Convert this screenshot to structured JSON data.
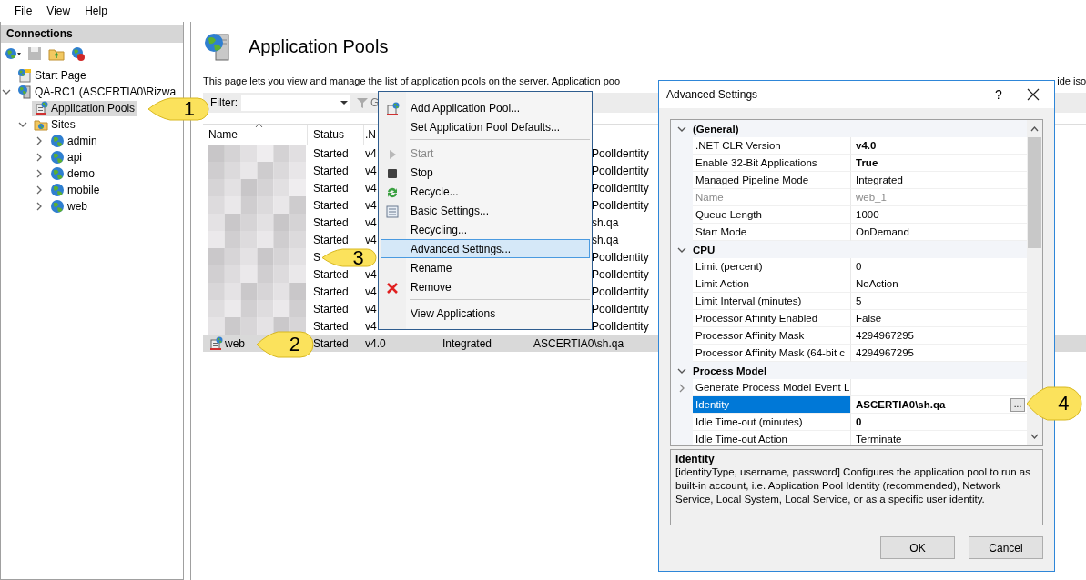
{
  "menu_bar": [
    "File",
    "View",
    "Help"
  ],
  "connections": {
    "title": "Connections",
    "tree": [
      {
        "label": "Start Page",
        "kind": "start",
        "selected": false
      },
      {
        "label": "QA-RC1 (ASCERTIA0\\Rizwa",
        "kind": "server",
        "selected": false,
        "expanded": true,
        "children": [
          {
            "label": "Application Pools",
            "kind": "pools",
            "selected": true
          },
          {
            "label": "Sites",
            "kind": "folder",
            "selected": false,
            "expanded": true,
            "children": [
              {
                "label": "admin",
                "kind": "site",
                "selected": false,
                "expanded": false
              },
              {
                "label": "api",
                "kind": "site",
                "selected": false,
                "expanded": false
              },
              {
                "label": "demo",
                "kind": "site",
                "selected": false,
                "expanded": false
              },
              {
                "label": "mobile",
                "kind": "site",
                "selected": false,
                "expanded": false
              },
              {
                "label": "web",
                "kind": "site",
                "selected": false,
                "expanded": false
              }
            ]
          }
        ]
      }
    ]
  },
  "page": {
    "title": "Application Pools",
    "description": "This page lets you view and manage the list of application pools on the server. Application poo",
    "description_right": "ide iso",
    "filter_label": "Filter:",
    "go_button": "G"
  },
  "list": {
    "columns": [
      "Name",
      "Status",
      ".N"
    ],
    "rows": [
      {
        "status": "Started",
        "version": "v4",
        "identity": "PoolIdentity",
        "selected": false
      },
      {
        "status": "Started",
        "version": "v4",
        "identity": "PoolIdentity",
        "selected": false
      },
      {
        "status": "Started",
        "version": "v4",
        "identity": "PoolIdentity",
        "selected": false
      },
      {
        "status": "Started",
        "version": "v4",
        "identity": "PoolIdentity",
        "selected": false
      },
      {
        "status": "Started",
        "version": "v4",
        "identity": "sh.qa",
        "selected": false
      },
      {
        "status": "Started",
        "version": "v4",
        "identity": "sh.qa",
        "selected": false
      },
      {
        "status": "S",
        "identity": "PoolIdentity",
        "selected": false
      },
      {
        "status": "Started",
        "version": "v4",
        "identity": "PoolIdentity",
        "selected": false
      },
      {
        "status": "Started",
        "version": "v4",
        "identity": "PoolIdentity",
        "selected": false
      },
      {
        "status": "Started",
        "version": "v4",
        "identity": "PoolIdentity",
        "selected": false
      },
      {
        "status": "Started",
        "version": "v4",
        "identity": "PoolIdentity",
        "selected": false
      },
      {
        "name": "web",
        "status": "Started",
        "version": "v4.0",
        "pipeline": "Integrated",
        "identity": "ASCERTIA0\\sh.qa",
        "selected": true
      }
    ]
  },
  "context_menu": [
    {
      "kind": "item",
      "label": "Add Application Pool...",
      "disabled": false,
      "selected": false
    },
    {
      "kind": "item",
      "label": "Set Application Pool Defaults...",
      "disabled": false,
      "selected": false
    },
    {
      "kind": "separator"
    },
    {
      "kind": "item",
      "label": "Start",
      "disabled": true,
      "selected": false
    },
    {
      "kind": "item",
      "label": "Stop",
      "disabled": false,
      "selected": false
    },
    {
      "kind": "item",
      "label": "Recycle...",
      "disabled": false,
      "selected": false
    },
    {
      "kind": "item",
      "label": "Basic Settings...",
      "disabled": false,
      "selected": false
    },
    {
      "kind": "item",
      "label": "Recycling...",
      "disabled": false,
      "selected": false
    },
    {
      "kind": "item",
      "label": "Advanced Settings...",
      "disabled": false,
      "selected": true
    },
    {
      "kind": "item",
      "label": "Rename",
      "disabled": false,
      "selected": false
    },
    {
      "kind": "item",
      "label": "Remove",
      "disabled": false,
      "selected": false
    },
    {
      "kind": "separator"
    },
    {
      "kind": "item",
      "label": "View Applications",
      "disabled": false,
      "selected": false
    }
  ],
  "dialog": {
    "title": "Advanced Settings",
    "help": "?",
    "categories": [
      {
        "name": "(General)",
        "expanded": true,
        "properties": [
          {
            "name": ".NET CLR Version",
            "value": "v4.0",
            "bold": true,
            "disabled": false,
            "selected": false
          },
          {
            "name": "Enable 32-Bit Applications",
            "value": "True",
            "bold": true,
            "disabled": false,
            "selected": false
          },
          {
            "name": "Managed Pipeline Mode",
            "value": "Integrated",
            "bold": false,
            "disabled": false,
            "selected": false
          },
          {
            "name": "Name",
            "value": "web_1",
            "bold": false,
            "disabled": true,
            "selected": false
          },
          {
            "name": "Queue Length",
            "value": "1000",
            "bold": false,
            "disabled": false,
            "selected": false
          },
          {
            "name": "Start Mode",
            "value": "OnDemand",
            "bold": false,
            "disabled": false,
            "selected": false
          }
        ]
      },
      {
        "name": "CPU",
        "expanded": true,
        "properties": [
          {
            "name": "Limit (percent)",
            "value": "0",
            "bold": false,
            "disabled": false,
            "selected": false
          },
          {
            "name": "Limit Action",
            "value": "NoAction",
            "bold": false,
            "disabled": false,
            "selected": false
          },
          {
            "name": "Limit Interval (minutes)",
            "value": "5",
            "bold": false,
            "disabled": false,
            "selected": false
          },
          {
            "name": "Processor Affinity Enabled",
            "value": "False",
            "bold": false,
            "disabled": false,
            "selected": false
          },
          {
            "name": "Processor Affinity Mask",
            "value": "4294967295",
            "bold": false,
            "disabled": false,
            "selected": false
          },
          {
            "name": "Processor Affinity Mask (64-bit c",
            "value": "4294967295",
            "bold": false,
            "disabled": false,
            "selected": false
          }
        ]
      },
      {
        "name": "Process Model",
        "expanded": true,
        "properties": [
          {
            "name": "Generate Process Model Event L",
            "disabled": false,
            "selected": false,
            "expanded": false
          },
          {
            "name": "Identity",
            "value": "ASCERTIA0\\sh.qa",
            "bold": true,
            "disabled": false,
            "selected": true,
            "browse_button": "..."
          },
          {
            "name": "Idle Time-out (minutes)",
            "value": "0",
            "bold": true,
            "disabled": false,
            "selected": false
          },
          {
            "name": "Idle Time-out Action",
            "value": "Terminate",
            "bold": false,
            "disabled": false,
            "selected": false
          }
        ]
      }
    ],
    "description": {
      "title": "Identity",
      "text": "[identityType, username, password] Configures the application pool to run as built-in account, i.e. Application Pool Identity (recommended), Network Service, Local System, Local Service, or as a specific user identity."
    },
    "buttons": [
      "OK",
      "Cancel"
    ]
  },
  "callouts": [
    "1",
    "2",
    "3",
    "4"
  ]
}
